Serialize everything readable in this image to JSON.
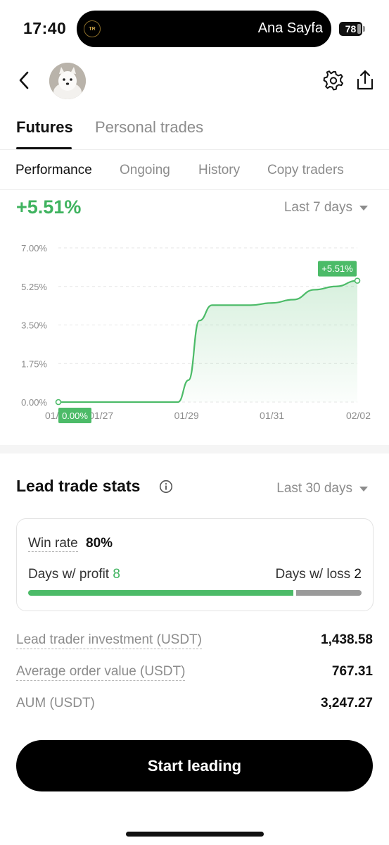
{
  "status_bar": {
    "time": "17:40",
    "island_logo_text": "TR",
    "island_text": "Ana Sayfa",
    "battery": "78"
  },
  "header": {
    "back_icon": "chevron-left-icon",
    "avatar": "white-dog-avatar",
    "settings_icon": "gear-icon",
    "share_icon": "share-icon"
  },
  "tabs": {
    "main": [
      {
        "label": "Futures",
        "active": true
      },
      {
        "label": "Personal trades",
        "active": false
      }
    ],
    "sub": [
      {
        "label": "Performance",
        "active": true
      },
      {
        "label": "Ongoing",
        "active": false
      },
      {
        "label": "History",
        "active": false
      },
      {
        "label": "Copy traders",
        "active": false
      }
    ]
  },
  "performance": {
    "value": "+5.51%",
    "range": "Last 7 days"
  },
  "chart_data": {
    "type": "area",
    "x_ticks": [
      "01/",
      "01/27",
      "01/29",
      "01/31",
      "02/02"
    ],
    "y_ticks": [
      "7.00%",
      "5.25%",
      "3.50%",
      "1.75%",
      "0.00%"
    ],
    "ylim": [
      0,
      7
    ],
    "xlim": [
      0,
      7
    ],
    "x": [
      0,
      1,
      2,
      2.8,
      3.05,
      3.3,
      3.6,
      4,
      4.5,
      5,
      5.5,
      6,
      6.5,
      7
    ],
    "values": [
      0,
      0,
      0,
      0,
      1.0,
      3.7,
      4.4,
      4.4,
      4.4,
      4.5,
      4.65,
      5.1,
      5.25,
      5.51
    ],
    "start_label": "0.00%",
    "end_label": "+5.51%",
    "grid": true,
    "color": "#4cbb68"
  },
  "lead_stats": {
    "title": "Lead trade stats",
    "range": "Last 30 days",
    "win_rate_label": "Win rate",
    "win_rate": "80%",
    "profit_label": "Days w/ profit",
    "profit_days": "8",
    "loss_label": "Days w/ loss",
    "loss_days": "2",
    "profit_fraction": 0.8,
    "rows": [
      {
        "label": "Lead trader investment (USDT)",
        "value": "1,438.58",
        "dashed": true
      },
      {
        "label": "Average order value (USDT)",
        "value": "767.31",
        "dashed": true
      },
      {
        "label": "AUM (USDT)",
        "value": "3,247.27",
        "dashed": false
      }
    ]
  },
  "cta": {
    "label": "Start leading"
  }
}
